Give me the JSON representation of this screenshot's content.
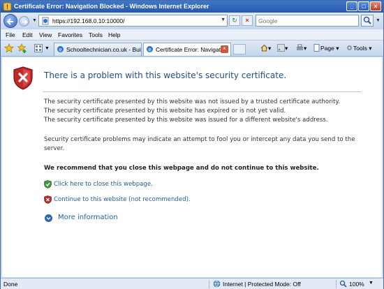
{
  "window": {
    "title": "Certificate Error: Navigation Blocked - Windows Internet Explorer",
    "controls": [
      "minimize",
      "maximize",
      "close"
    ]
  },
  "address_bar": {
    "url": "https://192.168.0.10:10000/",
    "search_placeholder": "Google"
  },
  "menu": {
    "items": [
      {
        "label": "File"
      },
      {
        "label": "Edit"
      },
      {
        "label": "View"
      },
      {
        "label": "Favorites"
      },
      {
        "label": "Tools"
      },
      {
        "label": "Help"
      }
    ]
  },
  "tabs": [
    {
      "label": "Schooltechnician.co.uk - Buil...",
      "active": false
    },
    {
      "label": "Certificate Error: Navigat...",
      "active": true
    }
  ],
  "command_bar": {
    "page_label": "Page",
    "tools_label": "Tools"
  },
  "content": {
    "headline": "There is a problem with this website's security certificate.",
    "reasons": [
      "The security certificate presented by this website was not issued by a trusted certificate authority.",
      "The security certificate presented by this website has expired or is not yet valid.",
      "The security certificate presented by this website was issued for a different website's address."
    ],
    "warning_line1": "Security certificate problems may indicate an attempt to fool you or intercept any data you send to the",
    "warning_line2": "server.",
    "recommendation": "We recommend that you close this webpage and do not continue to this website.",
    "close_link": "Click here to close this webpage.",
    "continue_link": "Continue to this website (not recommended).",
    "more_info": "More information"
  },
  "status_bar": {
    "status": "Done",
    "zone": "Internet | Protected Mode: Off",
    "zoom": "100%"
  },
  "colors": {
    "title_bar": "#2558ae",
    "headline": "#1f4e8c",
    "link": "#1f5fa5",
    "shield_red": "#c0282a",
    "safe_green": "#3a9a3a"
  }
}
